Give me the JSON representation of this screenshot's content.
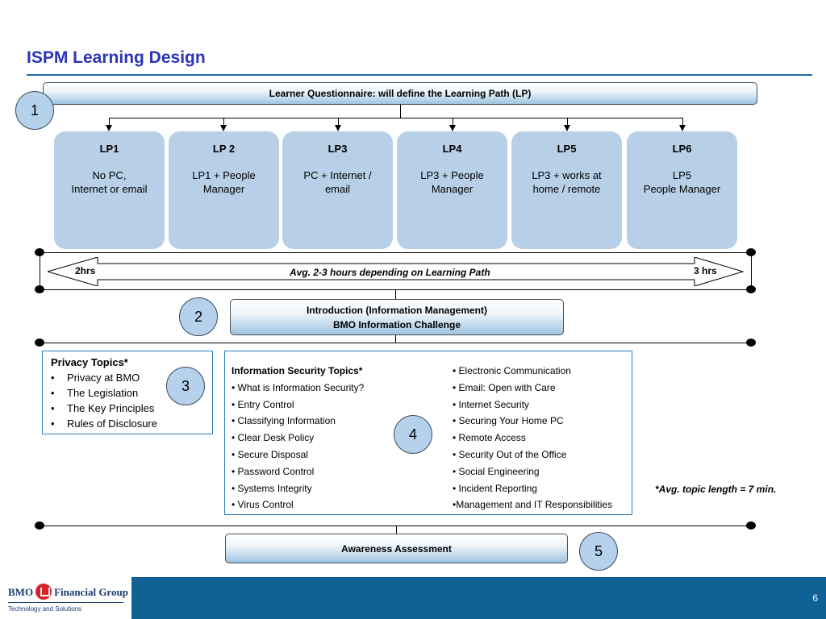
{
  "slide": {
    "title": "ISPM Learning Design",
    "page_number": "6"
  },
  "questionnaire": {
    "label": "Learner Questionnaire: will define the Learning Path (LP)"
  },
  "learning_paths": [
    {
      "name": "LP1",
      "desc": "No PC,\nInternet or email"
    },
    {
      "name": "LP 2",
      "desc": "LP1 +  People\nManager"
    },
    {
      "name": "LP3",
      "desc": "PC + Internet /\nemail"
    },
    {
      "name": "LP4",
      "desc": "LP3 +  People\nManager"
    },
    {
      "name": "LP5",
      "desc": "LP3 + works at\nhome / remote"
    },
    {
      "name": "LP6",
      "desc": "LP5\nPeople Manager"
    }
  ],
  "duration": {
    "min": "2hrs",
    "max": "3 hrs",
    "avg": "Avg. 2-3 hours depending on Learning Path"
  },
  "steps": [
    "1",
    "2",
    "3",
    "4",
    "5"
  ],
  "intro": {
    "line1": "Introduction (Information Management)",
    "line2": "BMO Information Challenge"
  },
  "privacy": {
    "title": "Privacy Topics*",
    "bullet": "•",
    "items": [
      "Privacy at BMO",
      "The Legislation",
      "The Key Principles",
      "Rules of Disclosure"
    ]
  },
  "infosec": {
    "title": "Information Security Topics*",
    "left": [
      "• What is Information Security?",
      "• Entry Control",
      "• Classifying Information",
      "• Clear Desk Policy",
      "• Secure Disposal",
      "• Password Control",
      "• Systems Integrity",
      "• Virus Control"
    ],
    "right": [
      "• Electronic Communication",
      "• Email: Open with Care",
      "• Internet Security",
      "• Securing Your Home PC",
      "• Remote Access",
      "• Security Out of the Office",
      "• Social Engineering",
      "• Incident Reporting",
      "•Management and IT Responsibilities"
    ]
  },
  "note": "*Avg. topic length = 7 min.",
  "assessment": {
    "label": "Awareness Assessment"
  },
  "footer": {
    "brand_left": "BMO",
    "brand_right": "Financial Group",
    "subtitle": "Technology and Solutions"
  }
}
